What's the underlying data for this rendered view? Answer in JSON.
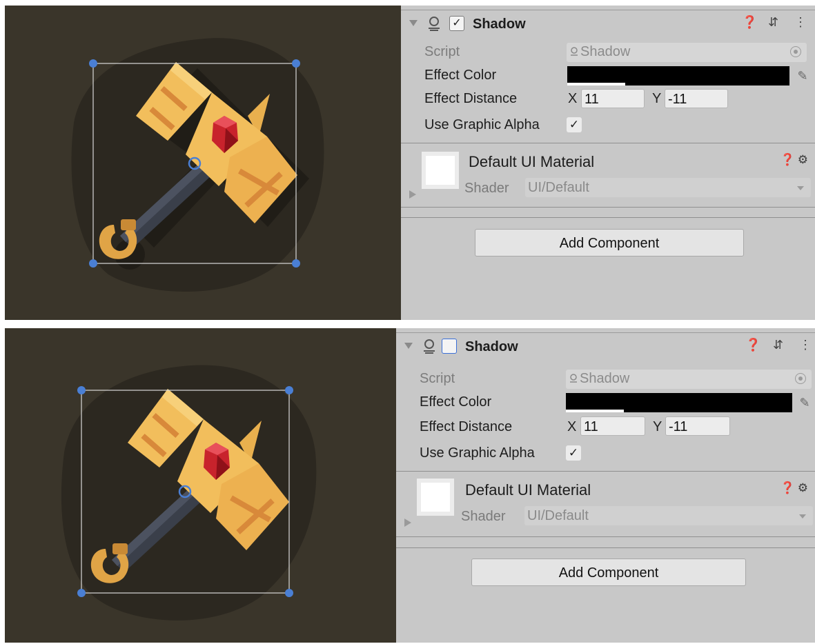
{
  "panels": [
    {
      "component": {
        "title": "Shadow",
        "enabled": true,
        "enabled_glyph": "✓",
        "header_icons": [
          "help-icon",
          "preset-icon",
          "more-icon"
        ],
        "help_glyph": "❓",
        "preset_glyph": "⇵",
        "more_glyph": "⋮"
      },
      "fields": {
        "script_label": "Script",
        "script_value": "Shadow",
        "effect_color_label": "Effect Color",
        "effect_color": "#000000",
        "effect_distance_label": "Effect Distance",
        "x_label": "X",
        "x_value": "11",
        "y_label": "Y",
        "y_value": "-11",
        "use_graphic_alpha_label": "Use Graphic Alpha",
        "use_graphic_alpha_glyph": "✓"
      },
      "material": {
        "title": "Default UI Material",
        "shader_label": "Shader",
        "shader_value": "UI/Default",
        "icons_glyph": "❓⚙"
      },
      "add_component_label": "Add Component"
    },
    {
      "component": {
        "title": "Shadow",
        "enabled": false,
        "enabled_glyph": "",
        "header_icons": [
          "help-icon",
          "preset-icon",
          "more-icon"
        ],
        "help_glyph": "❓",
        "preset_glyph": "⇵",
        "more_glyph": "⋮"
      },
      "fields": {
        "script_label": "Script",
        "script_value": "Shadow",
        "effect_color_label": "Effect Color",
        "effect_color": "#000000",
        "effect_distance_label": "Effect Distance",
        "x_label": "X",
        "x_value": "11",
        "y_label": "Y",
        "y_value": "-11",
        "use_graphic_alpha_label": "Use Graphic Alpha",
        "use_graphic_alpha_glyph": "✓"
      },
      "material": {
        "title": "Default UI Material",
        "shader_label": "Shader",
        "shader_value": "UI/Default",
        "icons_glyph": "❓⚙"
      },
      "add_component_label": "Add Component"
    }
  ],
  "colors": {
    "scene_bg": "#3a352a",
    "inspector_bg": "#c8c8c8",
    "handle_blue": "#4a7fd4",
    "hammer_gold": "#f2be5c",
    "gem_red": "#c8232c"
  }
}
